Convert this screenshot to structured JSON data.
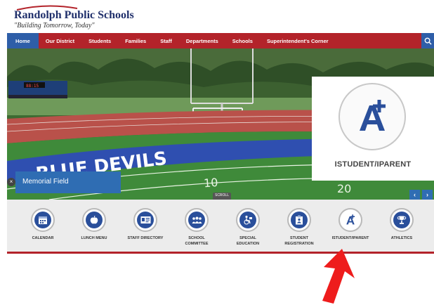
{
  "school": {
    "name": "Randolph Public Schools",
    "tagline": "\"Building Tomorrow, Today\""
  },
  "nav": {
    "items": [
      {
        "label": "Home"
      },
      {
        "label": "Our District"
      },
      {
        "label": "Students"
      },
      {
        "label": "Families"
      },
      {
        "label": "Staff"
      },
      {
        "label": "Departments"
      },
      {
        "label": "Schools"
      },
      {
        "label": "Superintendent's Corner"
      }
    ],
    "search_icon": "search-icon"
  },
  "hero": {
    "caption": "Memorial Field",
    "scroll_label": "SCROLL",
    "prev": "‹",
    "next": "›",
    "close": "×"
  },
  "callout": {
    "label": "ISTUDENT/IPARENT"
  },
  "quicklinks": [
    {
      "label": "CALENDAR",
      "icon": "calendar-icon"
    },
    {
      "label": "LUNCH MENU",
      "icon": "apple-icon"
    },
    {
      "label": "STAFF DIRECTORY",
      "icon": "id-card-icon"
    },
    {
      "label": "SCHOOL\nCOMMITTEE",
      "icon": "people-icon"
    },
    {
      "label": "SPECIAL\nEDUCATION",
      "icon": "accessibility-icon"
    },
    {
      "label": "STUDENT\nREGISTRATION",
      "icon": "clipboard-icon"
    },
    {
      "label": "ISTUDENT/IPARENT",
      "icon": "a-plus-icon"
    },
    {
      "label": "ATHLETICS",
      "icon": "trophy-icon"
    }
  ],
  "colors": {
    "nav_bg": "#b3232a",
    "accent_blue": "#2e5ea8",
    "icon_blue": "#2a4f9b",
    "arrow_red": "#ee1c1c"
  }
}
